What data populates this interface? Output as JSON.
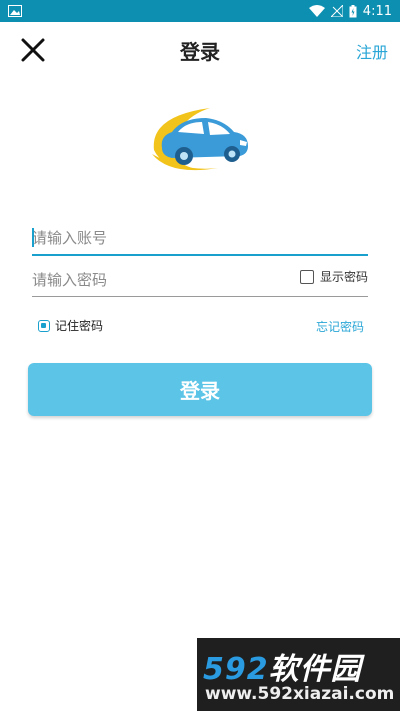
{
  "status_bar": {
    "time": "4:11"
  },
  "header": {
    "title": "登录",
    "register_label": "注册"
  },
  "form": {
    "account_placeholder": "请输入账号",
    "password_placeholder": "请输入密码",
    "show_password_label": "显示密码",
    "remember_password_label": "记住密码",
    "remember_password_checked": true,
    "show_password_checked": false,
    "forgot_password_label": "忘记密码",
    "login_button_label": "登录"
  },
  "watermark": {
    "brand_number": "592",
    "brand_text": "软件园",
    "url": "www.592xiazai.com"
  },
  "colors": {
    "status_bar": "#0c8fb0",
    "accent": "#29a6d6",
    "login_button": "#5cc4e7",
    "logo_car": "#3a9bd8",
    "logo_swoosh": "#f2c31b"
  }
}
